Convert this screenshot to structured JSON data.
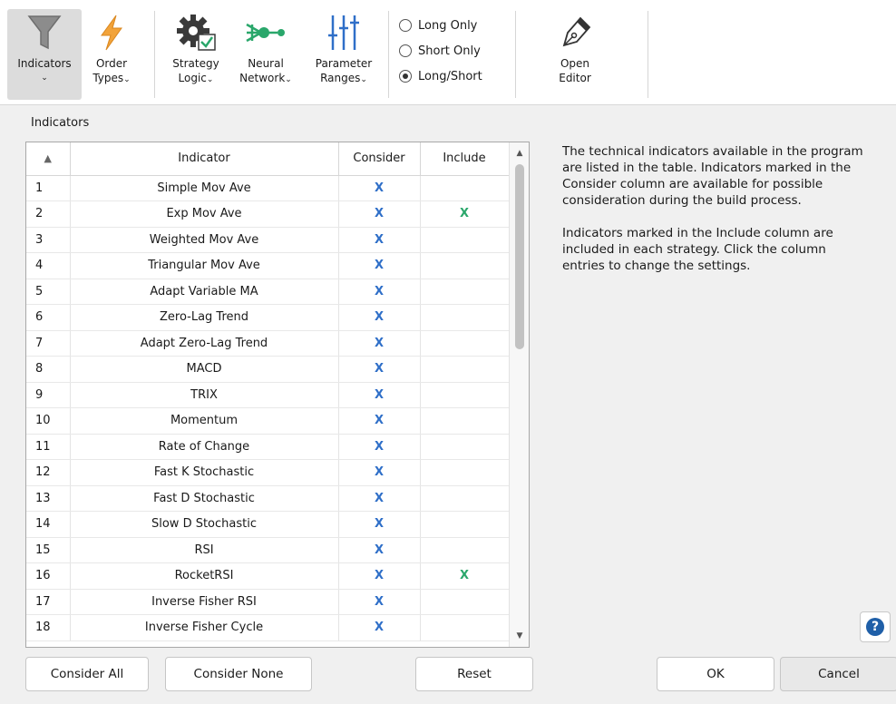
{
  "ribbon": {
    "indicators": {
      "line1": "Indicators",
      "line2": "",
      "chev": "⌄"
    },
    "order_types": {
      "line1": "Order",
      "line2": "Types",
      "chev": "⌄"
    },
    "strategy_logic": {
      "line1": "Strategy",
      "line2": "Logic",
      "chev": "⌄"
    },
    "neural_network": {
      "line1": "Neural",
      "line2": "Network",
      "chev": "⌄"
    },
    "parameter_ranges": {
      "line1": "Parameter",
      "line2": "Ranges",
      "chev": "⌄"
    },
    "radio": {
      "long_only": "Long Only",
      "short_only": "Short Only",
      "long_short": "Long/Short",
      "selected": "Long/Short"
    },
    "open_editor": {
      "line1": "Open",
      "line2": "Editor"
    }
  },
  "panel_label": "Indicators",
  "table": {
    "columns": [
      "",
      "Indicator",
      "Consider",
      "Include"
    ],
    "sort_indicator": "▲",
    "rows": [
      {
        "num": "1",
        "name": "Simple Mov Ave",
        "consider": "X",
        "include": ""
      },
      {
        "num": "2",
        "name": "Exp Mov Ave",
        "consider": "X",
        "include": "X"
      },
      {
        "num": "3",
        "name": "Weighted Mov Ave",
        "consider": "X",
        "include": ""
      },
      {
        "num": "4",
        "name": "Triangular Mov Ave",
        "consider": "X",
        "include": ""
      },
      {
        "num": "5",
        "name": "Adapt Variable MA",
        "consider": "X",
        "include": ""
      },
      {
        "num": "6",
        "name": "Zero-Lag Trend",
        "consider": "X",
        "include": ""
      },
      {
        "num": "7",
        "name": "Adapt Zero-Lag Trend",
        "consider": "X",
        "include": ""
      },
      {
        "num": "8",
        "name": "MACD",
        "consider": "X",
        "include": ""
      },
      {
        "num": "9",
        "name": "TRIX",
        "consider": "X",
        "include": ""
      },
      {
        "num": "10",
        "name": "Momentum",
        "consider": "X",
        "include": ""
      },
      {
        "num": "11",
        "name": "Rate of Change",
        "consider": "X",
        "include": ""
      },
      {
        "num": "12",
        "name": "Fast K Stochastic",
        "consider": "X",
        "include": ""
      },
      {
        "num": "13",
        "name": "Fast D Stochastic",
        "consider": "X",
        "include": ""
      },
      {
        "num": "14",
        "name": "Slow D Stochastic",
        "consider": "X",
        "include": ""
      },
      {
        "num": "15",
        "name": "RSI",
        "consider": "X",
        "include": ""
      },
      {
        "num": "16",
        "name": "RocketRSI",
        "consider": "X",
        "include": "X"
      },
      {
        "num": "17",
        "name": "Inverse Fisher RSI",
        "consider": "X",
        "include": ""
      },
      {
        "num": "18",
        "name": "Inverse Fisher Cycle",
        "consider": "X",
        "include": ""
      }
    ]
  },
  "description": {
    "para1": "The technical indicators available in the program are listed in the table. Indicators marked in the Consider column are available for possible consideration during the build process.",
    "para2": "Indicators marked in the Include column are included in each strategy. Click the column entries to change the settings."
  },
  "buttons": {
    "consider_all": "Consider All",
    "consider_none": "Consider None",
    "reset": "Reset",
    "ok": "OK",
    "cancel": "Cancel",
    "help": "?"
  },
  "colors": {
    "consider_x": "#2f6fc8",
    "include_x": "#2aa76b",
    "order_types_icon": "#f2a33a",
    "neural_icon": "#2aa76b",
    "parameter_icon": "#2f6fc8"
  }
}
